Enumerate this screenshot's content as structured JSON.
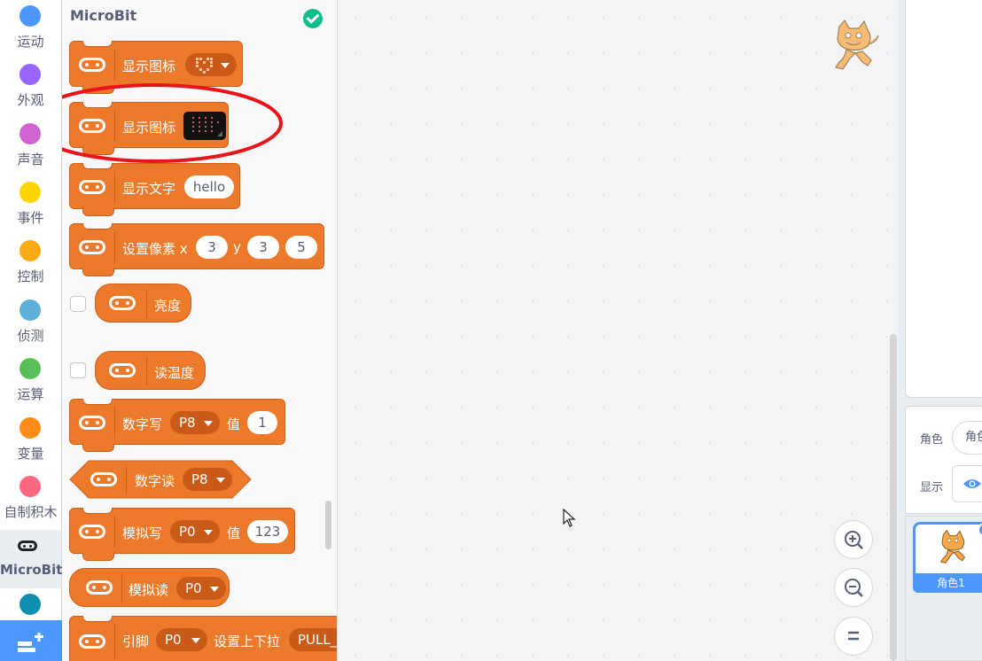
{
  "categories": [
    {
      "label": "运动",
      "color": "#4c97ff"
    },
    {
      "label": "外观",
      "color": "#9966ff"
    },
    {
      "label": "声音",
      "color": "#cf63cf"
    },
    {
      "label": "事件",
      "color": "#ffd500"
    },
    {
      "label": "控制",
      "color": "#ffab19"
    },
    {
      "label": "侦测",
      "color": "#5cb1d6"
    },
    {
      "label": "运算",
      "color": "#59c059"
    },
    {
      "label": "变量",
      "color": "#ff8c1a"
    },
    {
      "label": "自制积木",
      "color": "#ff6680"
    },
    {
      "label": "MicroBit",
      "icon": "microbit-icon",
      "active": true
    },
    {
      "label": "",
      "color": "#0d8fb0"
    }
  ],
  "flyout": {
    "title": "MicroBit",
    "blocks": {
      "show_icon_1": "显示图标",
      "show_icon_2": "显示图标",
      "show_text": "显示文字",
      "show_text_value": "hello",
      "set_pixel": "设置像素 x",
      "set_pixel_x": "3",
      "set_pixel_y_label": "y",
      "set_pixel_y": "3",
      "set_pixel_v": "5",
      "brightness": "亮度",
      "read_temp": "读温度",
      "digital_write": "数字写",
      "digital_write_pin": "P8",
      "digital_write_value_label": "值",
      "digital_write_value": "1",
      "digital_read": "数字读",
      "digital_read_pin": "P8",
      "analog_write": "模拟写",
      "analog_write_pin": "P0",
      "analog_write_value_label": "值",
      "analog_write_value": "123",
      "analog_read": "模拟读",
      "analog_read_pin": "P0",
      "pin_pull": "引脚",
      "pin_pull_pin": "P0",
      "pin_pull_label": "设置上下拉",
      "pin_pull_value": "PULL_"
    }
  },
  "right_panel": {
    "sprite_label": "角色",
    "sprite_name_value": "角色",
    "show_label": "显示",
    "sprite_card_name": "角色1"
  },
  "colors": {
    "extension_orange": "#ed7a2a",
    "highlight_ellipse": "#e8141b",
    "accent_blue": "#4c97ff"
  }
}
